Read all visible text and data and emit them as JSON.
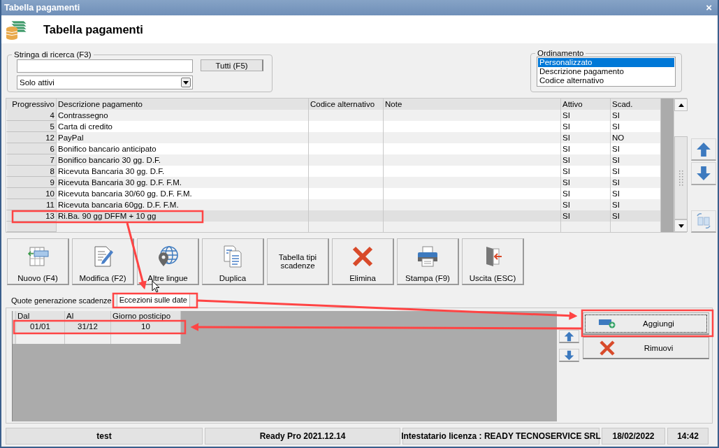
{
  "window": {
    "title": "Tabella pagamenti",
    "close": "×"
  },
  "header": {
    "title": "Tabella pagamenti"
  },
  "search": {
    "label": "Stringa di ricerca (F3)",
    "button": "Tutti (F5)",
    "filter": "Solo attivi"
  },
  "ordering": {
    "label": "Ordinamento",
    "options": [
      {
        "label": "Personalizzato",
        "selected": true
      },
      {
        "label": "Descrizione pagamento",
        "selected": false
      },
      {
        "label": "Codice alternativo",
        "selected": false
      }
    ]
  },
  "table": {
    "columns": [
      "Progressivo",
      "Descrizione pagamento",
      "Codice alternativo",
      "Note",
      "Attivo",
      "Scad."
    ],
    "rows": [
      {
        "progressivo": "4",
        "descrizione": "Contrassegno",
        "attivo": "SI",
        "scad": "SI",
        "selected": false
      },
      {
        "progressivo": "5",
        "descrizione": "Carta di credito",
        "attivo": "SI",
        "scad": "SI",
        "selected": false
      },
      {
        "progressivo": "12",
        "descrizione": "PayPal",
        "attivo": "SI",
        "scad": "NO",
        "selected": false
      },
      {
        "progressivo": "6",
        "descrizione": "Bonifico bancario anticipato",
        "attivo": "SI",
        "scad": "SI",
        "selected": false
      },
      {
        "progressivo": "7",
        "descrizione": "Bonifico bancario 30 gg. D.F.",
        "attivo": "SI",
        "scad": "SI",
        "selected": false
      },
      {
        "progressivo": "8",
        "descrizione": "Ricevuta Bancaria 30 gg. D.F.",
        "attivo": "SI",
        "scad": "SI",
        "selected": false
      },
      {
        "progressivo": "9",
        "descrizione": "Ricevuta Bancaria 30 gg. D.F. F.M.",
        "attivo": "SI",
        "scad": "SI",
        "selected": false
      },
      {
        "progressivo": "10",
        "descrizione": "Ricevuta bancaria 30/60 gg. D.F. F.M.",
        "attivo": "SI",
        "scad": "SI",
        "selected": false
      },
      {
        "progressivo": "11",
        "descrizione": "Ricevuta bancaria 60gg. D.F. F.M.",
        "attivo": "SI",
        "scad": "SI",
        "selected": false
      },
      {
        "progressivo": "13",
        "descrizione": "Ri.Ba. 90 gg DFFM + 10 gg",
        "attivo": "SI",
        "scad": "SI",
        "selected": true
      }
    ]
  },
  "toolbar": [
    {
      "label": "Nuovo (F4)",
      "kind": "new"
    },
    {
      "label": "Modifica (F2)",
      "kind": "edit"
    },
    {
      "label": "Altre lingue",
      "kind": "languages"
    },
    {
      "label": "Duplica",
      "kind": "duplicate"
    },
    {
      "label": "Tabella tipi scadenze",
      "kind": "text"
    },
    {
      "label": "Elimina",
      "kind": "delete"
    },
    {
      "label": "Stampa (F9)",
      "kind": "print"
    },
    {
      "label": "Uscita (ESC)",
      "kind": "exit"
    }
  ],
  "tabs": [
    {
      "label": "Quote generazione scadenze",
      "selected": false
    },
    {
      "label": "Eccezioni sulle date",
      "selected": true
    }
  ],
  "exceptions": {
    "columns": [
      "Dal",
      "Al",
      "Giorno posticipo"
    ],
    "rows": [
      {
        "dal": "01/01",
        "al": "31/12",
        "giorno": "10"
      }
    ]
  },
  "actions": [
    {
      "label": "Aggiungi",
      "kind": "add",
      "focused": true
    },
    {
      "label": "Rimuovi",
      "kind": "remove",
      "focused": false
    }
  ],
  "status_bar": [
    "test",
    "Ready Pro 2021.12.14",
    "Intestatario licenza : READY TECNOSERVICE SRL",
    "18/02/2022",
    "14:42"
  ]
}
